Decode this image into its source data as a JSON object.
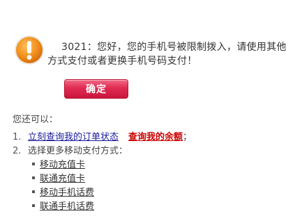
{
  "alert": {
    "icon": "exclamation-warning-icon",
    "message": "3021：您好，您的手机号被限制拨入，请使用其他方式支付或者更换手机号码支付！"
  },
  "buttons": {
    "confirm_label": "确定"
  },
  "options": {
    "title": "您还可以：",
    "items": [
      {
        "number": "1.",
        "link_order": "立刻查询我的订单状态",
        "link_balance": "查询我的余额",
        "suffix": "；"
      },
      {
        "number": "2.",
        "text": "选择更多移动支付方式："
      }
    ],
    "payment_methods": [
      "移动充值卡",
      "联通充值卡",
      "移动手机话费",
      "联通手机话费"
    ]
  },
  "colors": {
    "button_red": "#e12a52",
    "icon_orange": "#f08a1c",
    "link_blue": "#1a1a9a",
    "link_red": "#cc0000"
  }
}
